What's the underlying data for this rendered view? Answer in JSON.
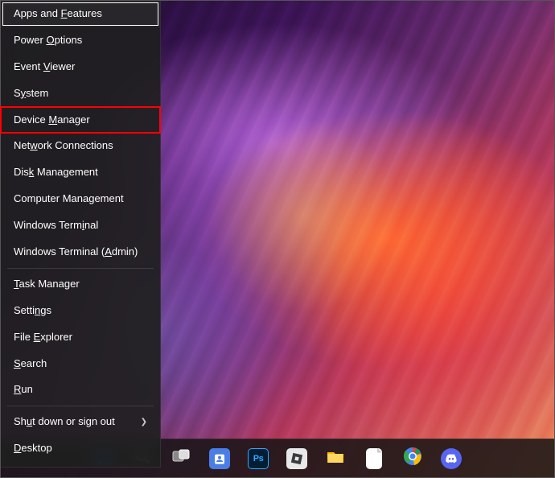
{
  "contextMenu": {
    "groups": [
      [
        {
          "pre": "Apps and ",
          "accel": "F",
          "post": "eatures",
          "name": "menu-apps-features",
          "selected": true
        },
        {
          "pre": "Power ",
          "accel": "O",
          "post": "ptions",
          "name": "menu-power-options"
        },
        {
          "pre": "Event ",
          "accel": "V",
          "post": "iewer",
          "name": "menu-event-viewer"
        },
        {
          "pre": "S",
          "accel": "y",
          "post": "stem",
          "name": "menu-system"
        },
        {
          "pre": "Device ",
          "accel": "M",
          "post": "anager",
          "name": "menu-device-manager",
          "highlighted": true
        },
        {
          "pre": "Net",
          "accel": "w",
          "post": "ork Connections",
          "name": "menu-network-connections"
        },
        {
          "pre": "Dis",
          "accel": "k",
          "post": " Management",
          "name": "menu-disk-management"
        },
        {
          "pre": "Computer Mana",
          "accel": "g",
          "post": "ement",
          "name": "menu-computer-management"
        },
        {
          "pre": "Windows Term",
          "accel": "i",
          "post": "nal",
          "name": "menu-windows-terminal"
        },
        {
          "pre": "Windows Terminal (",
          "accel": "A",
          "post": "dmin)",
          "name": "menu-windows-terminal-admin"
        }
      ],
      [
        {
          "pre": "",
          "accel": "T",
          "post": "ask Manager",
          "name": "menu-task-manager"
        },
        {
          "pre": "Setti",
          "accel": "n",
          "post": "gs",
          "name": "menu-settings"
        },
        {
          "pre": "File ",
          "accel": "E",
          "post": "xplorer",
          "name": "menu-file-explorer"
        },
        {
          "pre": "",
          "accel": "S",
          "post": "earch",
          "name": "menu-search"
        },
        {
          "pre": "",
          "accel": "R",
          "post": "un",
          "name": "menu-run"
        }
      ],
      [
        {
          "pre": "Sh",
          "accel": "u",
          "post": "t down or sign out",
          "name": "menu-shutdown-signout",
          "submenu": true
        },
        {
          "pre": "",
          "accel": "D",
          "post": "esktop",
          "name": "menu-desktop"
        }
      ]
    ]
  },
  "taskbar": {
    "items": [
      {
        "name": "start-button",
        "icon": "start-icon"
      },
      {
        "name": "search-button",
        "icon": "search-icon"
      },
      {
        "name": "task-view-button",
        "icon": "taskview-icon"
      },
      {
        "name": "chat-button",
        "icon": "chat-icon"
      },
      {
        "name": "photoshop-button",
        "icon": "photoshop-icon",
        "label": "Ps"
      },
      {
        "name": "roblox-button",
        "icon": "roblox-icon"
      },
      {
        "name": "file-explorer-button",
        "icon": "folder-icon"
      },
      {
        "name": "notepad-button",
        "icon": "file-icon"
      },
      {
        "name": "chrome-button",
        "icon": "chrome-icon"
      },
      {
        "name": "discord-button",
        "icon": "discord-icon"
      }
    ]
  }
}
